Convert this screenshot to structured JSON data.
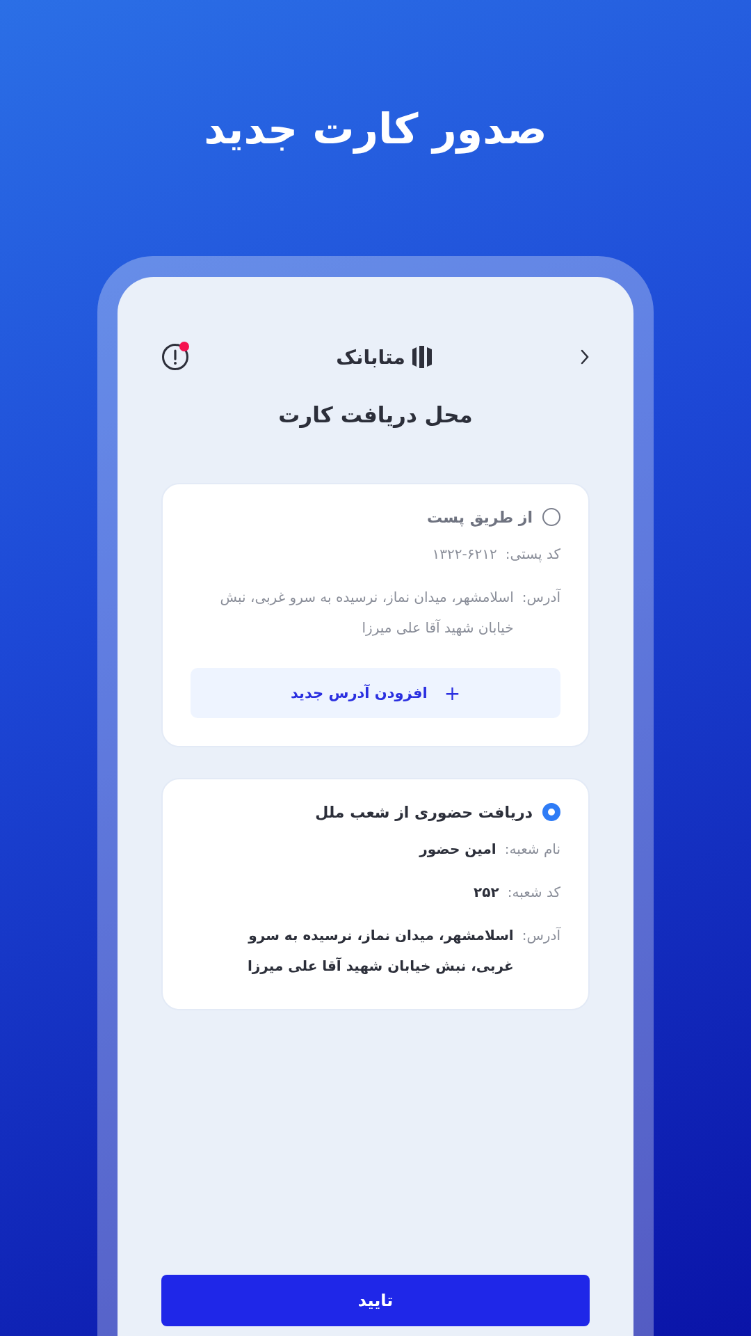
{
  "headline": "صدور کارت جدید",
  "header": {
    "logo_text": "متابانک",
    "has_notification": true
  },
  "title": "محل دریافت کارت",
  "options": [
    {
      "label": "از طریق پست",
      "selected": false,
      "fields": [
        {
          "label": "کد پستی:",
          "value": "۱۳۲۲-۶۲۱۲"
        },
        {
          "label": "آدرس:",
          "value": "اسلامشهر، میدان نماز، نرسیده به سرو غربی، نبش خیابان شهید آقا علی میرزا"
        }
      ],
      "action": {
        "icon": "+",
        "label": "افزودن آدرس جدید"
      }
    },
    {
      "label": "دریافت حضوری از شعب ملل",
      "selected": true,
      "fields": [
        {
          "label": "نام شعبه:",
          "value": "امین حضور"
        },
        {
          "label": "کد شعبه:",
          "value": "۲۵۲"
        },
        {
          "label": "آدرس:",
          "value": "اسلامشهر، میدان نماز، نرسیده به سرو غربی، نبش خیابان شهید آقا علی میرزا"
        }
      ]
    }
  ],
  "confirm_button": "تایید"
}
